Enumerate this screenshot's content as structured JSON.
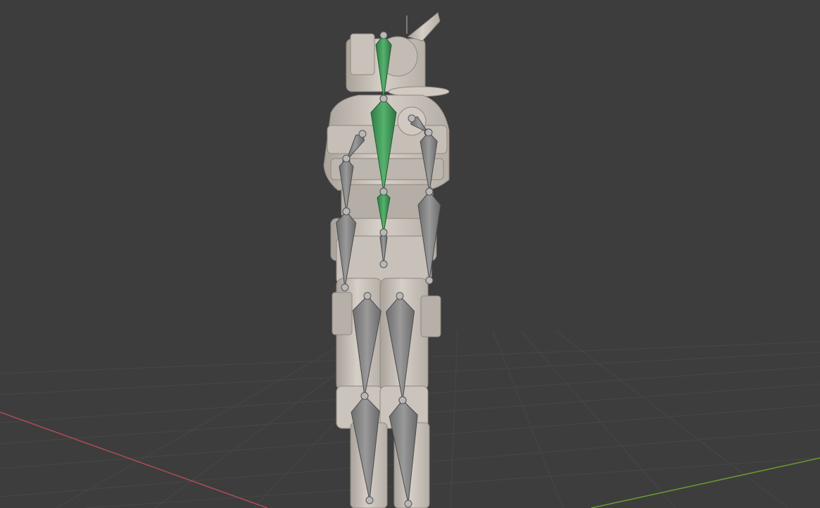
{
  "viewport": {
    "view": "3D viewport",
    "background_color": "#3d3d3d",
    "grid_color": "#474747",
    "x_axis_color": "#b04b55",
    "y_axis_color": "#6a9a32"
  },
  "scene": {
    "model": {
      "type": "robot mesh",
      "material_color": "#cfc8c0",
      "shade_color": "#a8a199"
    },
    "armature": {
      "selected_bone_color": "#4aa460",
      "bone_color": "#8c8c8c",
      "joint_color": "#b8b8b8",
      "bones": [
        {
          "name": "head",
          "selected": true
        },
        {
          "name": "chest",
          "selected": true
        },
        {
          "name": "spine",
          "selected": true
        },
        {
          "name": "pelvis",
          "selected": false
        },
        {
          "name": "shoulder-left",
          "selected": false
        },
        {
          "name": "shoulder-right",
          "selected": false
        },
        {
          "name": "upper-arm-left",
          "selected": false
        },
        {
          "name": "forearm-left",
          "selected": false
        },
        {
          "name": "upper-arm-right",
          "selected": false
        },
        {
          "name": "forearm-right",
          "selected": false
        },
        {
          "name": "thigh-left",
          "selected": false
        },
        {
          "name": "shin-left",
          "selected": false
        },
        {
          "name": "thigh-right",
          "selected": false
        },
        {
          "name": "shin-right",
          "selected": false
        }
      ]
    }
  }
}
